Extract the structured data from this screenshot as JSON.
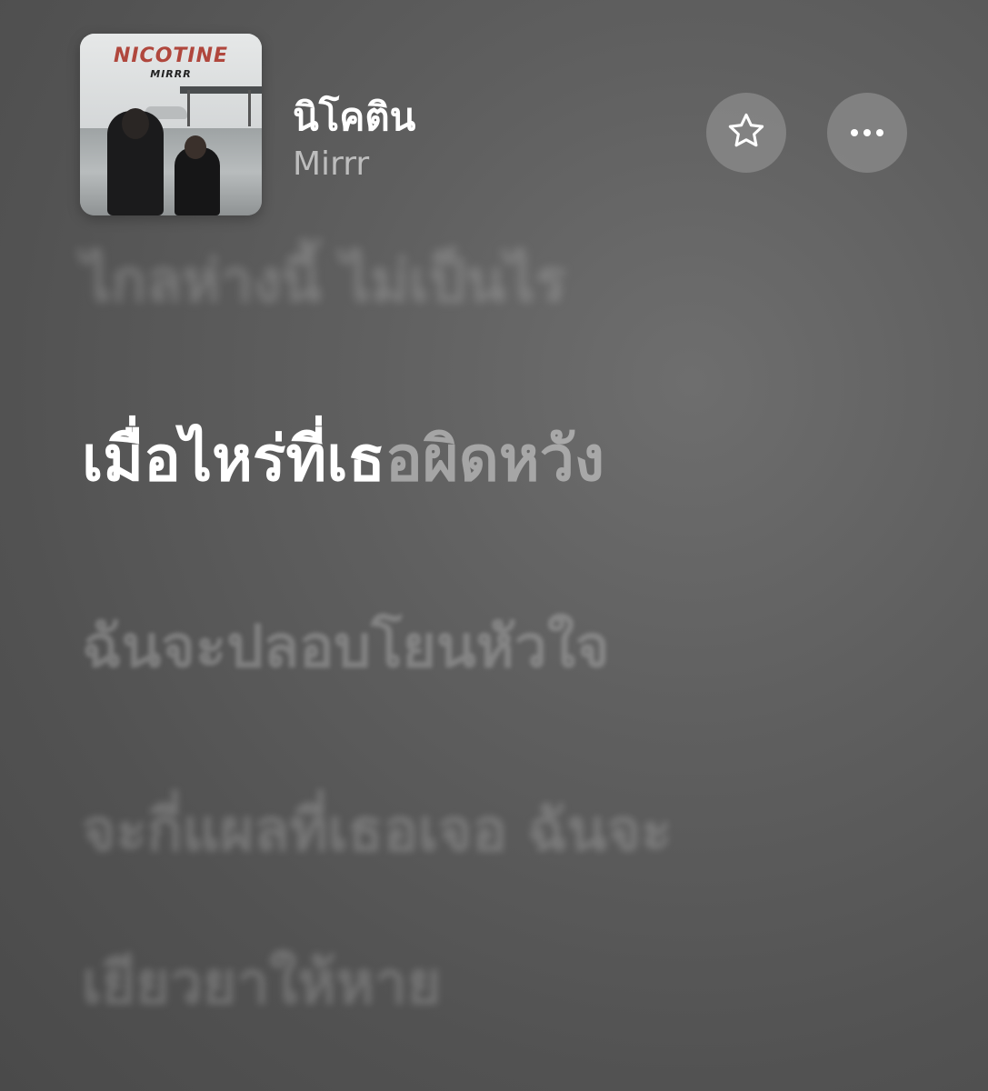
{
  "now_playing": {
    "title": "นิโคติน",
    "artist": "Mirrr",
    "album_art": {
      "title_text": "NICOTINE",
      "artist_text": "MIRRR"
    },
    "favorite_icon": "star-outline-icon",
    "more_icon": "ellipsis-icon"
  },
  "lyrics": {
    "previous_line": "ไกลห่างนี้ ไม่เป็นไร",
    "current_line_sung": "เมื่อไหร่ที่เธ",
    "current_line_unsung": "อผิดหวัง",
    "next_line": "ฉันจะปลอบโยนหัวใจ",
    "next_line_2": "จะกี่แผลที่เธอเจอ ฉันจะ",
    "next_line_3": "เยียวยาให้หาย"
  },
  "colors": {
    "active_lyric": "#ffffff",
    "inactive_lyric": "#c8c8c8",
    "button_bg": "#878787"
  }
}
